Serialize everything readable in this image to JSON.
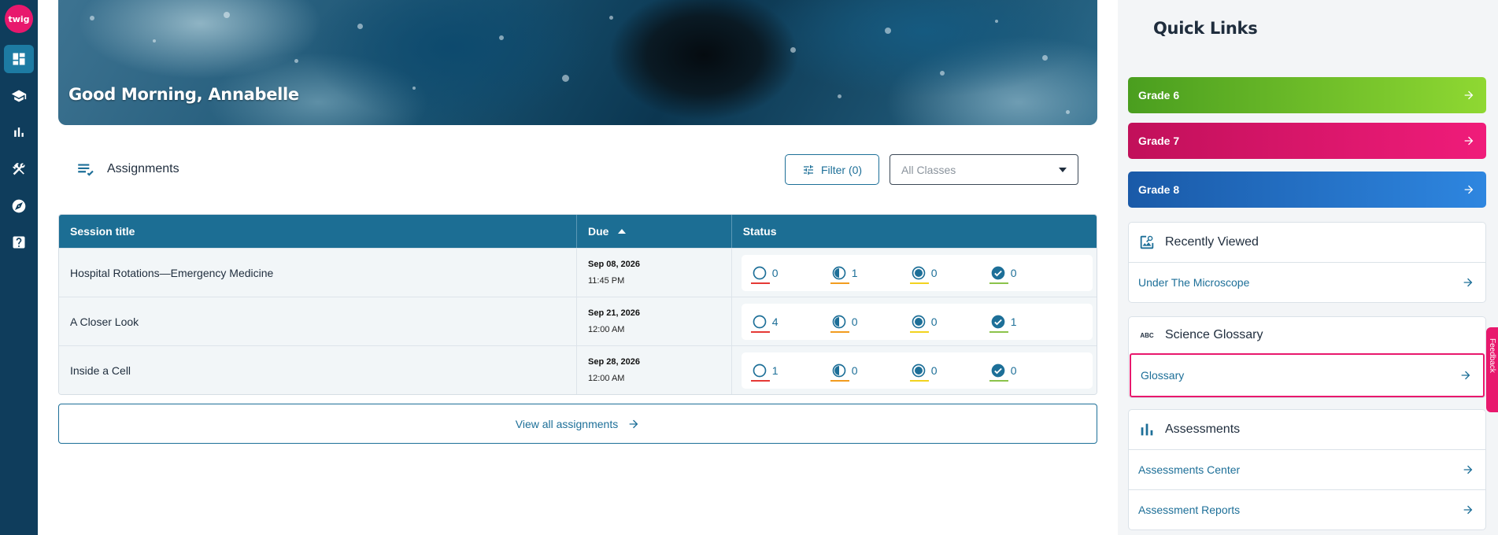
{
  "sidebar": {
    "logo_text": "twig",
    "items": [
      {
        "name": "dashboard",
        "active": true
      },
      {
        "name": "courses",
        "active": false
      },
      {
        "name": "reports",
        "active": false
      },
      {
        "name": "tools",
        "active": false
      },
      {
        "name": "explore",
        "active": false
      },
      {
        "name": "help",
        "active": false
      }
    ]
  },
  "hero": {
    "greeting": "Good Morning, Annabelle"
  },
  "assignments": {
    "title": "Assignments",
    "filter_label": "Filter (0)",
    "class_select": {
      "placeholder": "All Classes"
    },
    "columns": {
      "session_title": "Session title",
      "due": "Due",
      "status": "Status"
    },
    "rows": [
      {
        "title": "Hospital Rotations—Emergency Medicine",
        "due_date": "Sep 08, 2026",
        "due_time": "11:45 PM",
        "not_started": "0",
        "in_progress": "1",
        "submitted": "0",
        "completed": "0"
      },
      {
        "title": "A Closer Look",
        "due_date": "Sep 21, 2026",
        "due_time": "12:00 AM",
        "not_started": "4",
        "in_progress": "0",
        "submitted": "0",
        "completed": "1"
      },
      {
        "title": "Inside a Cell",
        "due_date": "Sep 28, 2026",
        "due_time": "12:00 AM",
        "not_started": "1",
        "in_progress": "0",
        "submitted": "0",
        "completed": "0"
      }
    ],
    "status_colors": {
      "not_started": "#e53935",
      "in_progress": "#f29c1f",
      "submitted": "#f2d31f",
      "completed": "#8bc34a"
    },
    "view_all_label": "View all assignments"
  },
  "quick_links": {
    "title": "Quick Links",
    "grades": [
      {
        "label": "Grade 6",
        "color_from": "#4a9e1f",
        "color_to": "#8fd832"
      },
      {
        "label": "Grade 7",
        "color_from": "#c1105a",
        "color_to": "#f01c7a"
      },
      {
        "label": "Grade 8",
        "color_from": "#1a5aa8",
        "color_to": "#2e86e0"
      }
    ],
    "recently_viewed": {
      "title": "Recently Viewed",
      "items": [
        "Under The Microscope"
      ]
    },
    "glossary": {
      "icon_text": "ABC",
      "title": "Science Glossary",
      "items": [
        "Glossary"
      ]
    },
    "assessments": {
      "title": "Assessments",
      "items": [
        "Assessments Center",
        "Assessment Reports"
      ]
    }
  },
  "feedback_label": "Feedback"
}
